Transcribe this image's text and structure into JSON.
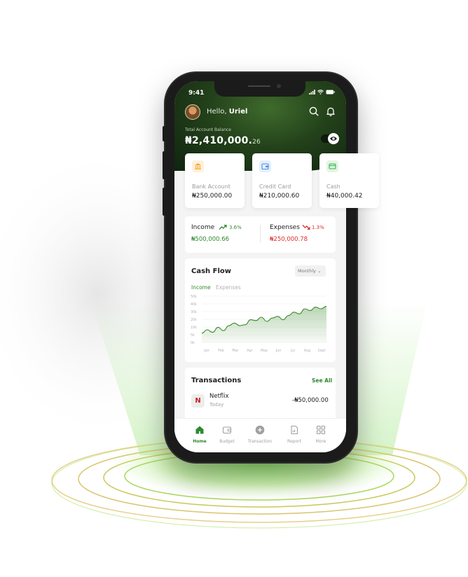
{
  "status": {
    "time": "9:41"
  },
  "header": {
    "greeting": "Hello,",
    "user_name": "Uriel",
    "search_icon": "search-icon",
    "bell_icon": "bell-icon"
  },
  "balance": {
    "label": "Total Account Balance",
    "amount": "₦2,410,000.",
    "cents": "26",
    "toggle_icon": "eye-icon"
  },
  "accounts": [
    {
      "name": "Bank Account",
      "value": "₦250,000.00",
      "icon": "bank-icon",
      "color": "#f6a21a"
    },
    {
      "name": "Credit Card",
      "value": "₦210,000.60",
      "icon": "wallet-icon",
      "color": "#4a8fe2"
    },
    {
      "name": "Cash",
      "value": "₦40,000.42",
      "icon": "cash-icon",
      "color": "#34b24a"
    }
  ],
  "summary": {
    "income": {
      "label": "Income",
      "pct": "3.6%",
      "value": "₦500,000.66",
      "color": "#2e8a2e"
    },
    "expenses": {
      "label": "Expenses",
      "pct": "1.3%",
      "value": "₦250,000.78",
      "color": "#e02c2c"
    }
  },
  "cashflow": {
    "title": "Cash Flow",
    "period": "Monthly",
    "tabs": [
      "Income",
      "Expenses"
    ],
    "active_tab": 0
  },
  "chart_data": {
    "type": "area",
    "title": "",
    "categories": [
      "Jan",
      "Feb",
      "Mar",
      "Apr",
      "May",
      "Jun",
      "Jul",
      "Aug",
      "Sept"
    ],
    "y_ticks": [
      "50k",
      "40k",
      "30k",
      "20k",
      "10k",
      "5k",
      "0k"
    ],
    "series": [
      {
        "values": [
          11,
          15,
          12,
          18,
          14,
          20,
          23,
          20,
          21,
          27,
          26,
          30,
          25,
          29,
          31,
          27,
          32,
          36,
          34,
          40,
          38,
          42,
          40,
          43
        ]
      }
    ],
    "ylim": [
      0,
      55
    ],
    "color": "#3a8a2a"
  },
  "transactions": {
    "title": "Transactions",
    "see_all": "See All",
    "items": [
      {
        "logo": "N",
        "name": "Netflix",
        "date": "Today",
        "amount": "-₦50,000.00"
      }
    ]
  },
  "tabbar": [
    {
      "label": "Home",
      "icon": "home-icon",
      "active": true
    },
    {
      "label": "Budget",
      "icon": "budget-icon",
      "active": false
    },
    {
      "label": "Transaction",
      "icon": "plus-circle-icon",
      "active": false
    },
    {
      "label": "Report",
      "icon": "report-icon",
      "active": false
    },
    {
      "label": "More",
      "icon": "grid-icon",
      "active": false
    }
  ]
}
